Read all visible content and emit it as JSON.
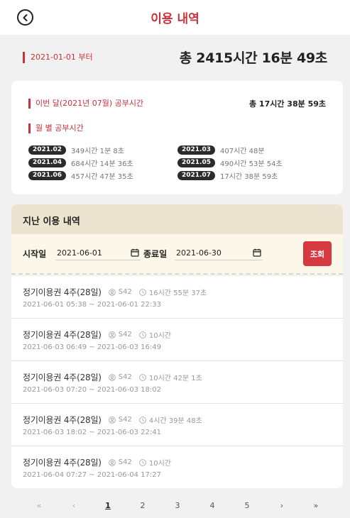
{
  "header": {
    "title": "이용 내역"
  },
  "summary": {
    "since": "2021-01-01 부터",
    "total": "총 2415시간 16분 49초"
  },
  "monthly": {
    "this_month_label": "이번 달(2021년 07월) 공부시간",
    "this_month_total": "총 17시간 38분 59초",
    "by_month_label": "월 별 공부시간",
    "rows": [
      {
        "month": "2021.02",
        "time": "349시간 1분 8초"
      },
      {
        "month": "2021.03",
        "time": "407시간 48분"
      },
      {
        "month": "2021.04",
        "time": "684시간 14분 36초"
      },
      {
        "month": "2021.05",
        "time": "490시간 53분 54초"
      },
      {
        "month": "2021.06",
        "time": "457시간 47분 35초"
      },
      {
        "month": "2021.07",
        "time": "17시간 38분 59초"
      }
    ]
  },
  "history": {
    "title": "지난 이용 내역",
    "start_label": "시작일",
    "start_value": "2021-06-01",
    "end_label": "종료일",
    "end_value": "2021-06-30",
    "search_label": "조회",
    "items": [
      {
        "name": "정기이용권 4주(28일)",
        "seat": "S42",
        "duration": "16시간 55분 37초",
        "range": "2021-06-01 05:38 ~ 2021-06-01 22:33"
      },
      {
        "name": "정기이용권 4주(28일)",
        "seat": "S42",
        "duration": "10시간",
        "range": "2021-06-03 06:49 ~ 2021-06-03 16:49"
      },
      {
        "name": "정기이용권 4주(28일)",
        "seat": "S42",
        "duration": "10시간 42분 1초",
        "range": "2021-06-03 07:20 ~ 2021-06-03 18:02"
      },
      {
        "name": "정기이용권 4주(28일)",
        "seat": "S42",
        "duration": "4시간 39분 48초",
        "range": "2021-06-03 18:02 ~ 2021-06-03 22:41"
      },
      {
        "name": "정기이용권 4주(28일)",
        "seat": "S42",
        "duration": "10시간",
        "range": "2021-06-04 07:27 ~ 2021-06-04 17:27"
      }
    ]
  },
  "pagination": {
    "first": "«",
    "prev": "‹",
    "pages": [
      "1",
      "2",
      "3",
      "4",
      "5"
    ],
    "current": "1",
    "next": "›",
    "last": "»"
  }
}
